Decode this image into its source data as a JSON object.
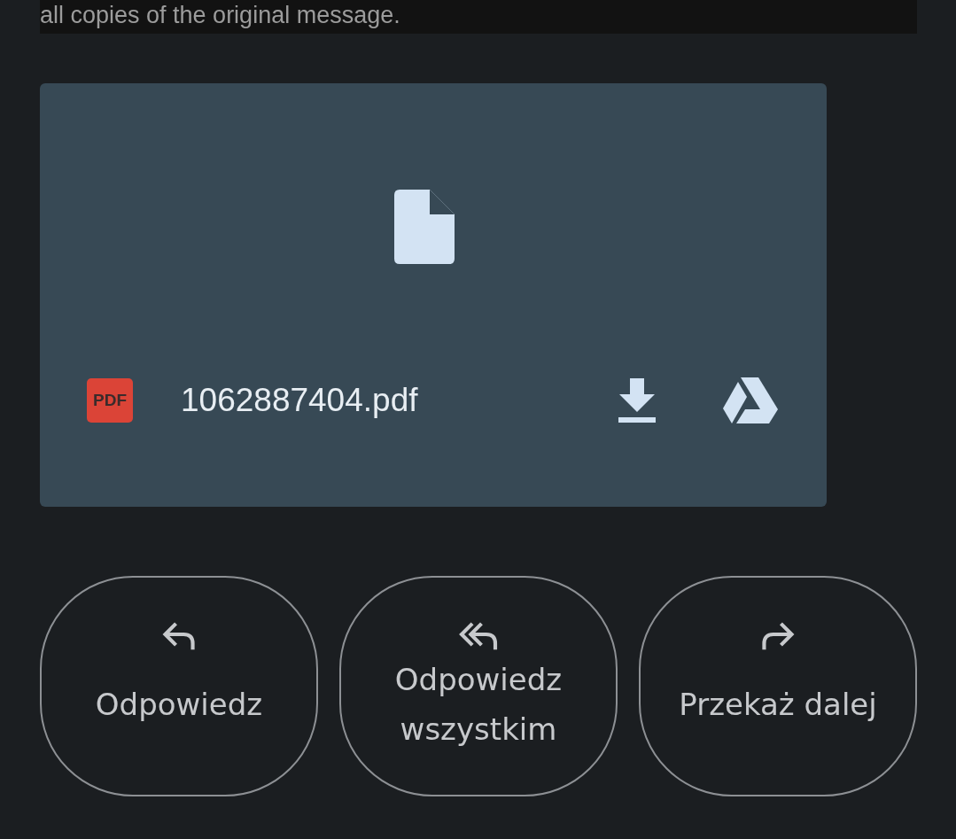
{
  "message_tail": {
    "text": "all copies of the original message."
  },
  "attachment": {
    "badge": "PDF",
    "filename": "1062887404.pdf"
  },
  "actions": [
    {
      "kind": "reply",
      "label": "Odpowiedz"
    },
    {
      "kind": "reply_all",
      "label": "Odpowiedz wszystkim"
    },
    {
      "kind": "forward",
      "label": "Przekaż dalej"
    }
  ]
}
